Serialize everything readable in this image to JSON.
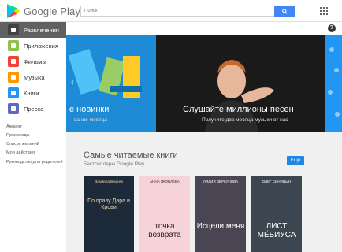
{
  "header": {
    "logo_text": "Google Play",
    "search_placeholder": "Поиск",
    "help_glyph": "?"
  },
  "sidebar": {
    "items": [
      {
        "label": "Развлечения",
        "icon": "entertainment-icon",
        "color": "#616161",
        "active": true
      },
      {
        "label": "Приложения",
        "icon": "android-icon",
        "color": "#8bc34a",
        "active": false
      },
      {
        "label": "Фильмы",
        "icon": "film-icon",
        "color": "#f44336",
        "active": false
      },
      {
        "label": "Музыка",
        "icon": "headphones-icon",
        "color": "#ff9800",
        "active": false
      },
      {
        "label": "Книги",
        "icon": "book-icon",
        "color": "#2196f3",
        "active": false
      },
      {
        "label": "Пресса",
        "icon": "newsstand-icon",
        "color": "#5c6bc0",
        "active": false
      }
    ],
    "links": [
      "Аккаунт",
      "Промокоды",
      "Список желаний",
      "Мои действия",
      "Руководство для родителей"
    ]
  },
  "banners": [
    {
      "title": "е новинки",
      "subtitle": "вание месяца",
      "color": "#1d8bd6"
    },
    {
      "title": "Слушайте миллионы песен",
      "subtitle": "Получите два месяца музыки от нас",
      "color": "#1a1a1a"
    },
    {
      "title": "",
      "subtitle": "",
      "color": "#2196f3"
    }
  ],
  "section": {
    "title": "Самые читаемые книги",
    "subtitle": "Бестселлеры Google Play",
    "more_label": "Ещё"
  },
  "books": [
    {
      "author": "Эльмира Вишняк",
      "title": "По праву Дара и Крови",
      "bg": "#1c2a3a",
      "fg": "#f3d8b0"
    },
    {
      "author": "АННА ЯКОВЛЕВА",
      "title": "точка возврата",
      "bg": "#f6d3d8",
      "fg": "#2b1b1f"
    },
    {
      "author": "ЛИДИЯ ДЕРКУНОВА",
      "title": "Исцели меня",
      "bg": "#4a4552",
      "fg": "#ffffff"
    },
    {
      "author": "ОЛЕГ СИНИЦЫН",
      "title": "ЛИСТ МЁБИУСА",
      "bg": "#3c4650",
      "fg": "#ffffff"
    }
  ]
}
